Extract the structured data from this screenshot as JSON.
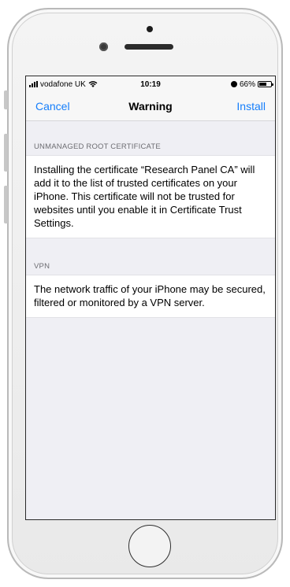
{
  "status_bar": {
    "carrier": "vodafone UK",
    "time": "10:19",
    "battery_percent": "66%",
    "battery_level": 0.66
  },
  "nav": {
    "cancel_label": "Cancel",
    "title": "Warning",
    "install_label": "Install"
  },
  "sections": [
    {
      "header": "UNMANAGED ROOT CERTIFICATE",
      "body": "Installing the certificate “Research Panel CA” will add it to the list of trusted certificates on your iPhone. This certificate will not be trusted for websites until you enable it in Certificate Trust Settings."
    },
    {
      "header": "VPN",
      "body": "The network traffic of your iPhone may be secured, filtered or monitored by a VPN server."
    }
  ],
  "colors": {
    "accent": "#157efb",
    "background": "#efeff4",
    "section_header": "#6d6d72"
  },
  "icons": {
    "signal": "signal-bars-icon",
    "wifi": "wifi-icon",
    "alarm": "alarm-icon",
    "battery": "battery-icon"
  }
}
